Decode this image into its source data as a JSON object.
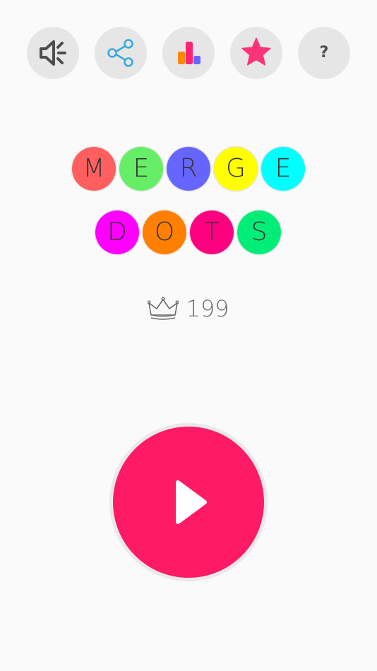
{
  "toolbar": {
    "buttons": [
      {
        "name": "sound-toggle-button",
        "icon": "speaker-muted-icon"
      },
      {
        "name": "share-button",
        "icon": "share-icon"
      },
      {
        "name": "leaderboard-button",
        "icon": "bar-chart-icon"
      },
      {
        "name": "rate-button",
        "icon": "star-icon"
      },
      {
        "name": "help-button",
        "icon": "question-mark-icon",
        "glyph": "?"
      }
    ]
  },
  "title": {
    "line1": [
      {
        "letter": "M",
        "color": "#ff5f5f"
      },
      {
        "letter": "E",
        "color": "#66ee66"
      },
      {
        "letter": "R",
        "color": "#6666ff"
      },
      {
        "letter": "G",
        "color": "#ffff00"
      },
      {
        "letter": "E",
        "color": "#00ffff"
      }
    ],
    "line2": [
      {
        "letter": "D",
        "color": "#ff00ff"
      },
      {
        "letter": "O",
        "color": "#ff8000"
      },
      {
        "letter": "T",
        "color": "#ff0080"
      },
      {
        "letter": "S",
        "color": "#00ee77"
      }
    ]
  },
  "best_score": {
    "icon": "crown-icon",
    "value": "199"
  },
  "play": {
    "icon": "play-icon",
    "color": "#ff1a66"
  },
  "colors": {
    "background": "#fafafa",
    "button_bg": "#e6e6e6",
    "icon_dark": "#4d4d4d",
    "share_blue": "#33aadd",
    "star_pink": "#ff3377",
    "bar_orange": "#ff8800",
    "bar_pink": "#ff2277",
    "bar_blue": "#6666ff"
  }
}
